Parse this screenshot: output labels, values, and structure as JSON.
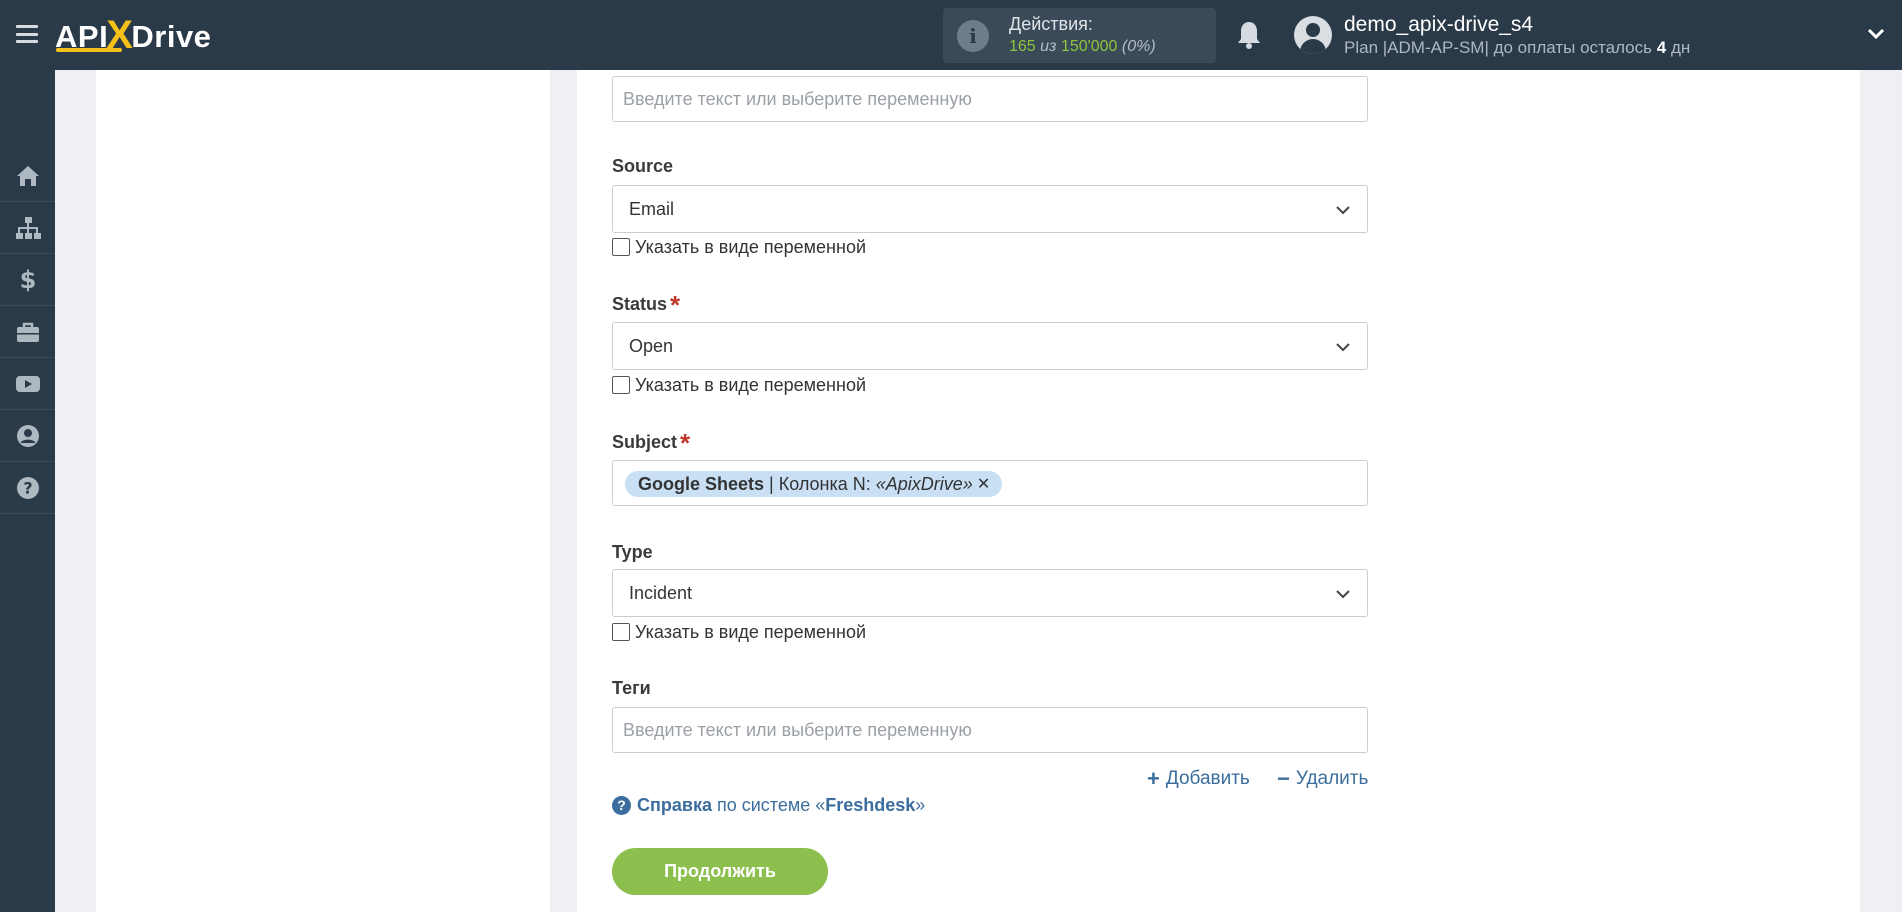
{
  "header": {
    "logo": {
      "part1": "API",
      "x": "X",
      "part2": "Drive"
    },
    "actions": {
      "title": "Действия:",
      "used": "165",
      "sep": "из",
      "limit": "150'000",
      "percent": "(0%)"
    },
    "user": {
      "name": "demo_apix-drive_s4",
      "plan_prefix": "Plan |ADM-AP-SM| до оплаты осталось",
      "days": "4",
      "days_unit": "дн"
    }
  },
  "sidebar": {
    "items": [
      {
        "icon": "home-icon"
      },
      {
        "icon": "sitemap-icon"
      },
      {
        "icon": "dollar-icon"
      },
      {
        "icon": "briefcase-icon"
      },
      {
        "icon": "youtube-icon"
      },
      {
        "icon": "user-circle-icon"
      },
      {
        "icon": "question-icon"
      }
    ]
  },
  "form": {
    "top_field": {
      "placeholder": "Введите текст или выберите переменную"
    },
    "source": {
      "label": "Source",
      "value": "Email",
      "checkbox": "Указать в виде переменной"
    },
    "status": {
      "label": "Status",
      "required": "*",
      "value": "Open",
      "checkbox": "Указать в виде переменной"
    },
    "subject": {
      "label": "Subject",
      "required": "*",
      "tag": {
        "source": "Google Sheets",
        "sep": "| Колонка N:",
        "value": "«ApixDrive»",
        "remove": "✕"
      }
    },
    "type": {
      "label": "Type",
      "value": "Incident",
      "checkbox": "Указать в виде переменной"
    },
    "tags": {
      "label": "Теги",
      "placeholder": "Введите текст или выберите переменную"
    },
    "add_label": "Добавить",
    "remove_label": "Удалить",
    "help": {
      "prefix": "Справка",
      "middle": "по системе «",
      "system": "Freshdesk",
      "suffix": "»"
    },
    "continue_label": "Продолжить"
  }
}
